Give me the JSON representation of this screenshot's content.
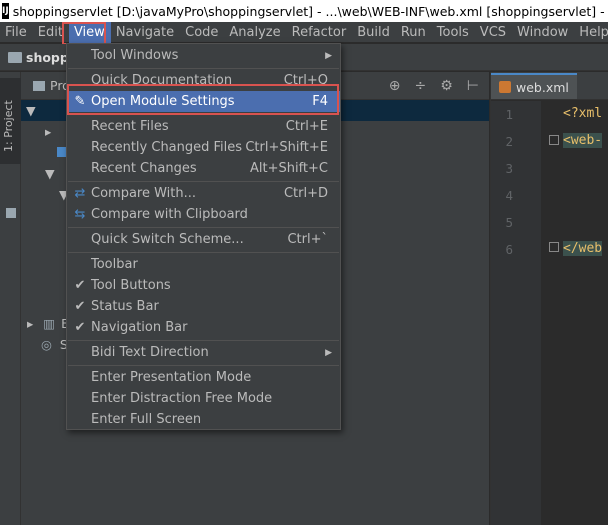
{
  "window": {
    "title": "shoppingservlet [D:\\javaMyPro\\shoppingservlet] - ...\\web\\WEB-INF\\web.xml [shoppingservlet] - IntelliJ IDEA"
  },
  "menubar": {
    "items": [
      "File",
      "Edit",
      "View",
      "Navigate",
      "Code",
      "Analyze",
      "Refactor",
      "Build",
      "Run",
      "Tools",
      "VCS",
      "Window",
      "Help"
    ]
  },
  "navbar": {
    "crumb": "shopp"
  },
  "side_strip": {
    "project_tab": "1: Project"
  },
  "project_panel": {
    "header": "Pro",
    "tree_fragments": [
      "s",
      "E",
      "S"
    ]
  },
  "editor": {
    "tab": "web.xml",
    "line_numbers": [
      "1",
      "2",
      "3",
      "4",
      "5",
      "6"
    ],
    "code_lines": [
      "<?xml",
      "<web-",
      "",
      "",
      "",
      "</web"
    ]
  },
  "view_menu": {
    "items": [
      {
        "label": "Tool Windows",
        "shortcut": "",
        "icon": "",
        "submenu": true
      },
      {
        "label": "Quick Documentation",
        "shortcut": "Ctrl+Q",
        "icon": ""
      },
      {
        "label": "Open Module Settings",
        "shortcut": "F4",
        "icon": "edit-icon",
        "highlighted": true
      },
      {
        "label": "Recent Files",
        "shortcut": "Ctrl+E",
        "icon": ""
      },
      {
        "label": "Recently Changed Files",
        "shortcut": "Ctrl+Shift+E",
        "icon": ""
      },
      {
        "label": "Recent Changes",
        "shortcut": "Alt+Shift+C",
        "icon": ""
      },
      {
        "label": "Compare With...",
        "shortcut": "Ctrl+D",
        "icon": "compare-icon"
      },
      {
        "label": "Compare with Clipboard",
        "shortcut": "",
        "icon": "clipboard-compare-icon"
      },
      {
        "label": "Quick Switch Scheme...",
        "shortcut": "Ctrl+`",
        "icon": ""
      },
      {
        "label": "Toolbar",
        "shortcut": "",
        "icon": ""
      },
      {
        "label": "Tool Buttons",
        "shortcut": "",
        "icon": "check-icon"
      },
      {
        "label": "Status Bar",
        "shortcut": "",
        "icon": "check-icon"
      },
      {
        "label": "Navigation Bar",
        "shortcut": "",
        "icon": "check-icon"
      },
      {
        "label": "Bidi Text Direction",
        "shortcut": "",
        "icon": "",
        "submenu": true
      },
      {
        "label": "Enter Presentation Mode",
        "shortcut": "",
        "icon": ""
      },
      {
        "label": "Enter Distraction Free Mode",
        "shortcut": "",
        "icon": ""
      },
      {
        "label": "Enter Full Screen",
        "shortcut": "",
        "icon": ""
      }
    ]
  },
  "colors": {
    "menu_bg": "#3c3f41",
    "highlight": "#4b6eaf",
    "annotation_red": "#d9534f",
    "editor_bg": "#2b2b2b"
  }
}
